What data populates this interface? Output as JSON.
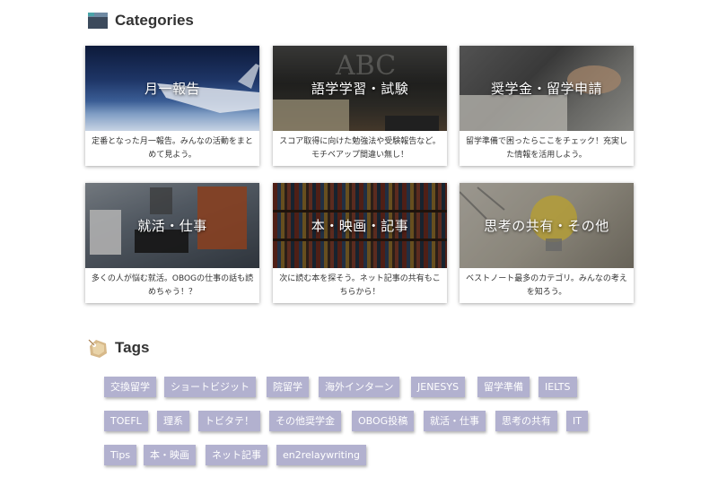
{
  "categories": {
    "title": "Categories",
    "icon": "folder-icon",
    "items": [
      {
        "label": "月一報告",
        "desc": "定番となった月一報告。みんなの活動をまとめて見よう。"
      },
      {
        "label": "語学学習・試験",
        "desc": "スコア取得に向けた勉強法や受験報告など。モチベアップ間違い無し！"
      },
      {
        "label": "奨学金・留学申請",
        "desc": "留学準備で困ったらここをチェック！充実した情報を活用しよう。"
      },
      {
        "label": "就活・仕事",
        "desc": "多くの人が悩む就活。OBOGの仕事の話も読めちゃう！？"
      },
      {
        "label": "本・映画・記事",
        "desc": "次に読む本を探そう。ネット記事の共有もこちらから！"
      },
      {
        "label": "思考の共有・その他",
        "desc": "ベストノート最多のカテゴリ。みんなの考えを知ろう。"
      }
    ]
  },
  "tags": {
    "title": "Tags",
    "icon": "tag-icon",
    "color": "#b2b1cf",
    "items": [
      "交換留学",
      "ショートビジット",
      "院留学",
      "海外インターン",
      "JENESYS",
      "留学準備",
      "IELTS",
      "TOEFL",
      "理系",
      "トビタテ！",
      "その他奨学金",
      "OBOG投稿",
      "就活・仕事",
      "思考の共有",
      "IT",
      "Tips",
      "本・映画",
      "ネット記事",
      "en2relaywriting"
    ]
  }
}
